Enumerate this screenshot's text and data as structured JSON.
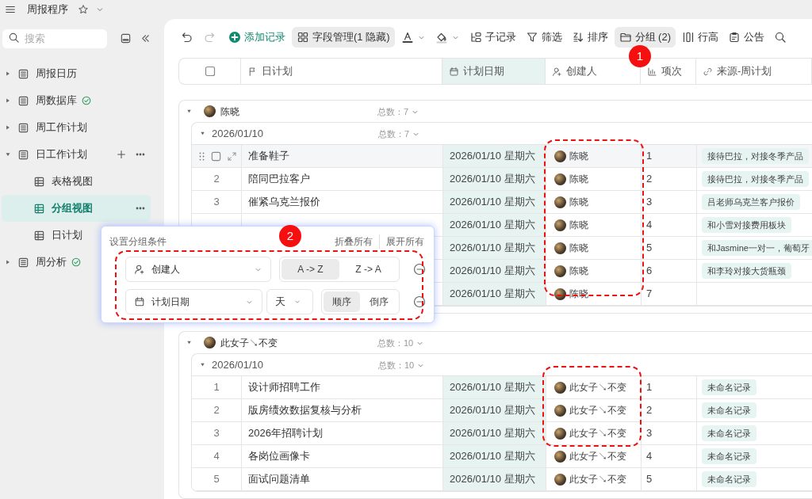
{
  "app": {
    "title": "周报程序"
  },
  "sidebar": {
    "search": {
      "placeholder": "搜索"
    },
    "items": [
      {
        "label": "周报日历",
        "expanded": false,
        "selected": false,
        "synced": false,
        "show_actions": false
      },
      {
        "label": "周数据库",
        "expanded": false,
        "selected": false,
        "synced": true,
        "show_actions": false
      },
      {
        "label": "周工作计划",
        "expanded": false,
        "selected": false,
        "synced": false,
        "show_actions": false
      },
      {
        "label": "日工作计划",
        "expanded": true,
        "selected": false,
        "synced": false,
        "show_actions": true,
        "children": [
          {
            "label": "表格视图",
            "selected": false,
            "synced": false,
            "show_actions": false
          },
          {
            "label": "分组视图",
            "selected": true,
            "synced": false,
            "show_actions": true
          },
          {
            "label": "日计划",
            "selected": false,
            "synced": false
          }
        ]
      },
      {
        "label": "周分析",
        "expanded": false,
        "selected": false,
        "synced": true,
        "show_actions": false
      }
    ]
  },
  "toolbar": [
    {
      "kind": "undo",
      "active": false
    },
    {
      "kind": "redo",
      "active": false
    },
    {
      "kind": "add",
      "label": "添加记录",
      "active": false
    },
    {
      "kind": "fields",
      "label": "字段管理(1 隐藏)",
      "active": true
    },
    {
      "kind": "text-color",
      "active": false
    },
    {
      "kind": "fill-color",
      "active": false
    },
    {
      "kind": "subrecord",
      "label": "子记录",
      "active": false
    },
    {
      "kind": "filter",
      "label": "筛选",
      "active": false
    },
    {
      "kind": "sort",
      "label": "排序",
      "active": false
    },
    {
      "kind": "group",
      "label": "分组 (2)",
      "active": true
    },
    {
      "kind": "row-height",
      "label": "行高",
      "active": false
    },
    {
      "kind": "notice",
      "label": "公告",
      "active": false
    },
    {
      "kind": "search",
      "active": false
    }
  ],
  "table": {
    "select_all": {
      "checked": false
    },
    "columns": [
      {
        "label": "日计划",
        "kind": "primary"
      },
      {
        "label": "计划日期",
        "kind": "date"
      },
      {
        "label": "创建人",
        "kind": "person"
      },
      {
        "label": "项次",
        "kind": "number"
      },
      {
        "label": "来源-周计划",
        "kind": "link"
      }
    ],
    "groups": [
      {
        "name": "陈晓",
        "total_label": "总数：",
        "total": "7",
        "subgroups": [
          {
            "name": "2026/01/10",
            "total_label": "总数：",
            "total": "7",
            "rows": [
              {
                "hovered": true,
                "checked": false,
                "title": "准备鞋子",
                "date": "2026/01/10 星期六",
                "creator": "陈晓",
                "seq": "1",
                "source": "接待巴拉，对接冬季产品"
              },
              {
                "hovered": false,
                "index": "2",
                "title": "陪同巴拉客户",
                "date": "2026/01/10 星期六",
                "creator": "陈晓",
                "seq": "2",
                "source": "接待巴拉，对接冬季产品"
              },
              {
                "hovered": false,
                "index": "3",
                "title": "催紧乌克兰报价",
                "date": "2026/01/10 星期六",
                "creator": "陈晓",
                "seq": "3",
                "source": "吕老师乌克兰客户报价"
              },
              {
                "hovered": false,
                "date": "2026/01/10 星期六",
                "creator": "陈晓",
                "seq": "4",
                "source": "和小雪对接费用板块"
              },
              {
                "date": "2026/01/10 星期六",
                "creator": "陈晓",
                "seq": "5",
                "source": "和Jasmine一对一，葡萄牙"
              },
              {
                "date": "2026/01/10 星期六",
                "creator": "陈晓",
                "seq": "6",
                "source": "和李玲对接大货瓶颈"
              },
              {
                "date": "2026/01/10 星期六",
                "creator": "陈晓",
                "seq": "7"
              }
            ]
          }
        ]
      },
      {
        "name": "此女子↘不变",
        "total_label": "总数：",
        "total": "10",
        "subgroups": [
          {
            "name": "2026/01/10",
            "total_label": "总数：",
            "total": "10",
            "rows": [
              {
                "hovered": false,
                "index": "1",
                "title": "设计师招聘工作",
                "date": "2026/01/10 星期六",
                "creator": "此女子↘不变",
                "seq": "1",
                "source": "未命名记录"
              },
              {
                "hovered": false,
                "index": "2",
                "title": "版房绩效数据复核与分析",
                "date": "2026/01/10 星期六",
                "creator": "此女子↘不变",
                "seq": "2",
                "source": "未命名记录"
              },
              {
                "hovered": false,
                "index": "3",
                "title": "2026年招聘计划",
                "date": "2026/01/10 星期六",
                "creator": "此女子↘不变",
                "seq": "3",
                "source": "未命名记录"
              },
              {
                "hovered": false,
                "index": "4",
                "title": "各岗位画像卡",
                "date": "2026/01/10 星期六",
                "creator": "此女子↘不变",
                "seq": "4",
                "source": "未命名记录"
              },
              {
                "hovered": false,
                "index": "5",
                "title": "面试问题清单",
                "date": "2026/01/10 星期六",
                "creator": "此女子↘不变",
                "seq": "5",
                "source": "未命名记录"
              }
            ]
          }
        ]
      }
    ]
  },
  "group_settings": {
    "title": "设置分组条件",
    "collapse_all": "折叠所有",
    "expand_all": "展开所有",
    "conditions": [
      {
        "field": "创建人",
        "kind": "person",
        "orders": [
          {
            "label": "A -> Z",
            "selected": true
          },
          {
            "label": "Z -> A",
            "selected": false
          }
        ]
      },
      {
        "field": "计划日期",
        "kind": "date",
        "granularity": "天",
        "orders": [
          {
            "label": "顺序",
            "selected": true
          },
          {
            "label": "倒序",
            "selected": false
          }
        ]
      }
    ]
  },
  "markers": [
    {
      "label": "1"
    },
    {
      "label": "2"
    }
  ]
}
